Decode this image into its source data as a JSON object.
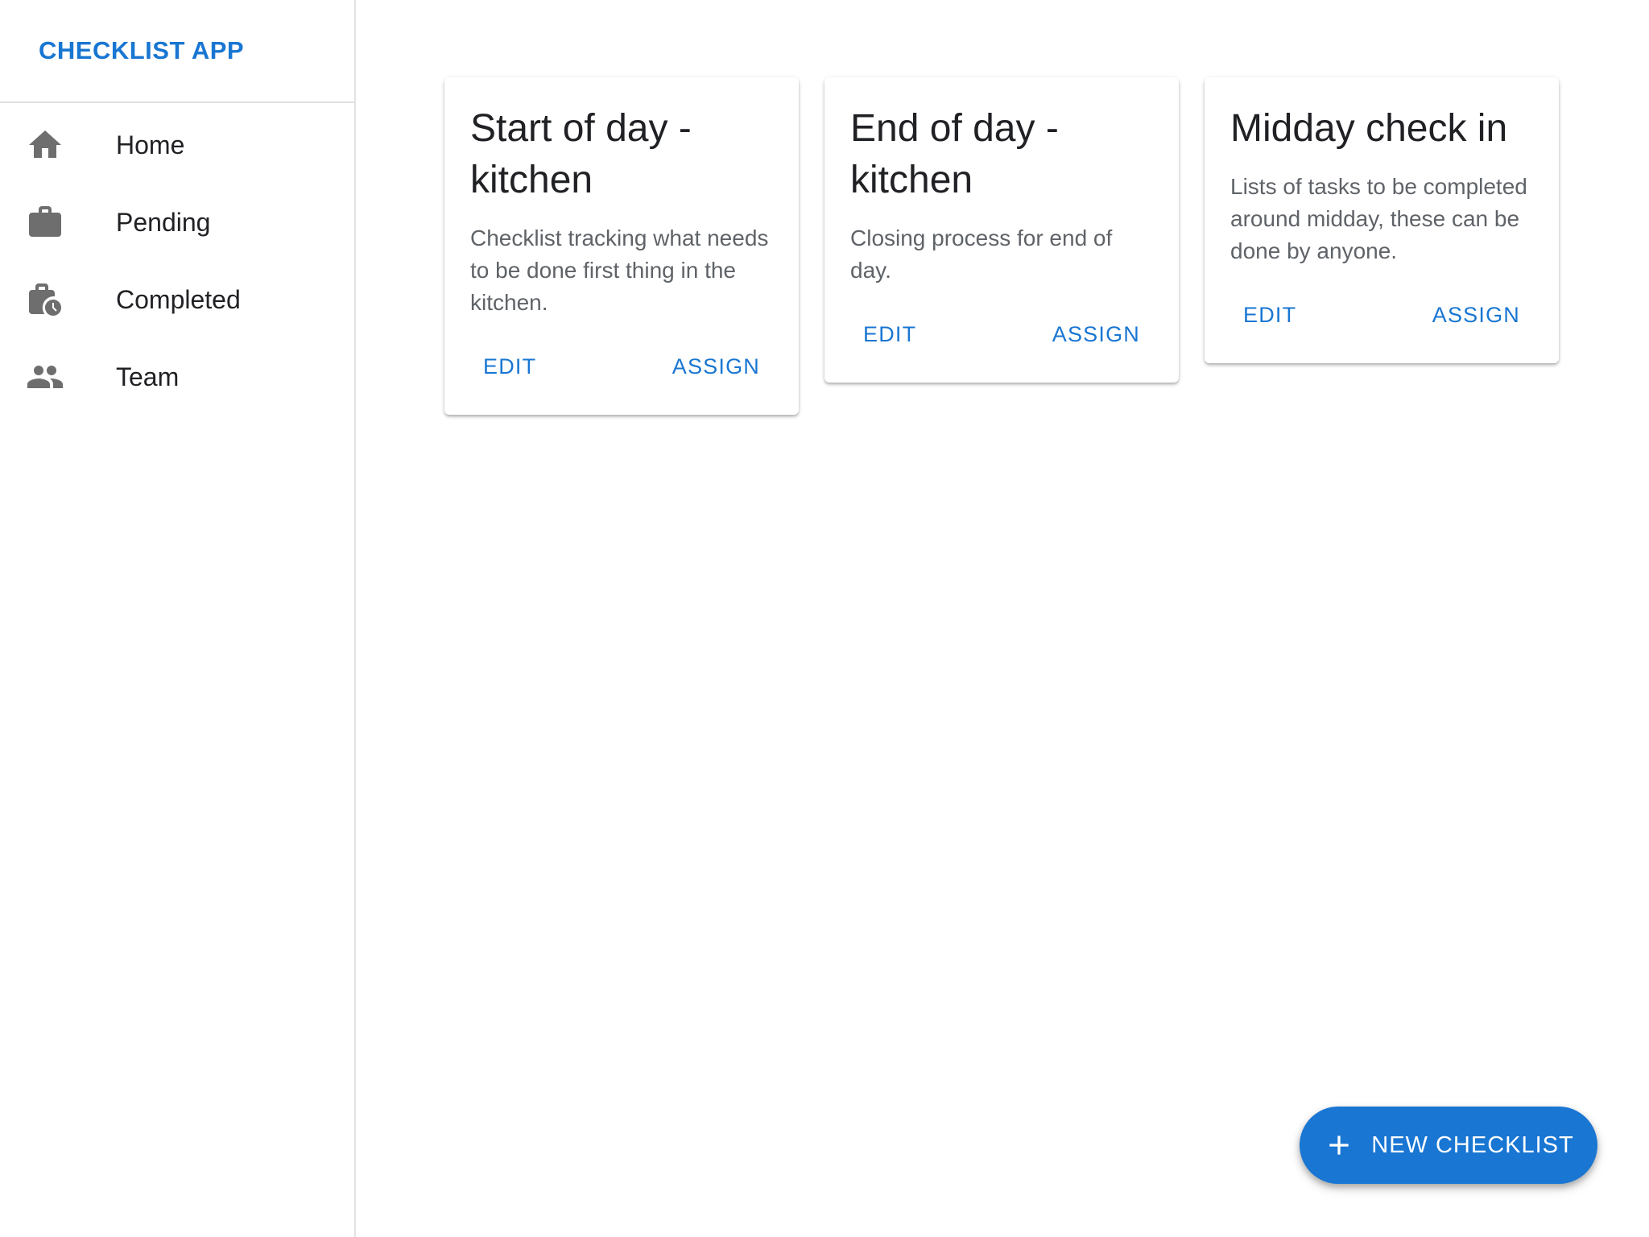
{
  "app": {
    "title": "CHECKLIST APP",
    "accent_color": "#1976d2"
  },
  "sidebar": {
    "items": [
      {
        "label": "Home",
        "icon": "home-icon"
      },
      {
        "label": "Pending",
        "icon": "briefcase-icon"
      },
      {
        "label": "Completed",
        "icon": "briefcase-clock-icon"
      },
      {
        "label": "Team",
        "icon": "people-icon"
      }
    ]
  },
  "cards": [
    {
      "title": "Start of day - kitchen",
      "description": "Checklist tracking what needs to be done first thing in the kitchen.",
      "edit_label": "EDIT",
      "assign_label": "ASSIGN"
    },
    {
      "title": "End of day - kitchen",
      "description": "Closing process for end of day.",
      "edit_label": "EDIT",
      "assign_label": "ASSIGN"
    },
    {
      "title": "Midday check in",
      "description": "Lists of tasks to be completed around midday, these can be done by anyone.",
      "edit_label": "EDIT",
      "assign_label": "ASSIGN"
    }
  ],
  "fab": {
    "label": "NEW CHECKLIST",
    "icon": "plus-icon"
  }
}
